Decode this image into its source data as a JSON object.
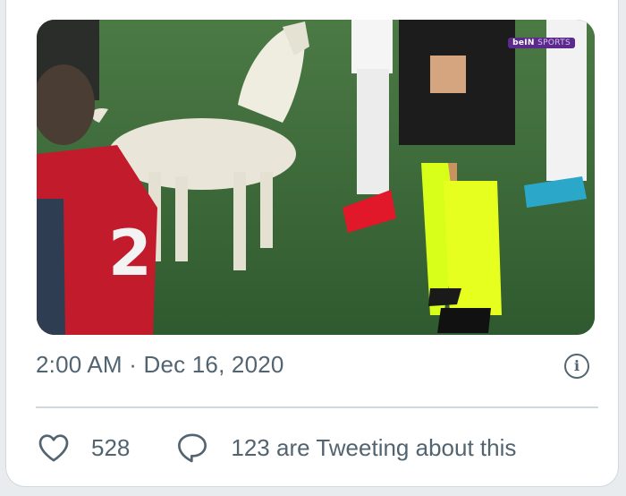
{
  "tweet": {
    "media": {
      "broadcaster_badge": {
        "main": "beIN",
        "sub": "SPORTS"
      }
    },
    "timestamp": "2:00 AM · Dec 16, 2020",
    "info_icon_glyph": "i",
    "actions": {
      "like_count": "528",
      "reply_label": "123 are Tweeting about this"
    }
  },
  "icons": {
    "like": "heart-icon",
    "reply": "speech-bubble-icon",
    "info": "info-icon"
  },
  "colors": {
    "secondary_text": "#536471",
    "divider": "#cfd9de",
    "card_background": "#ffffff"
  }
}
